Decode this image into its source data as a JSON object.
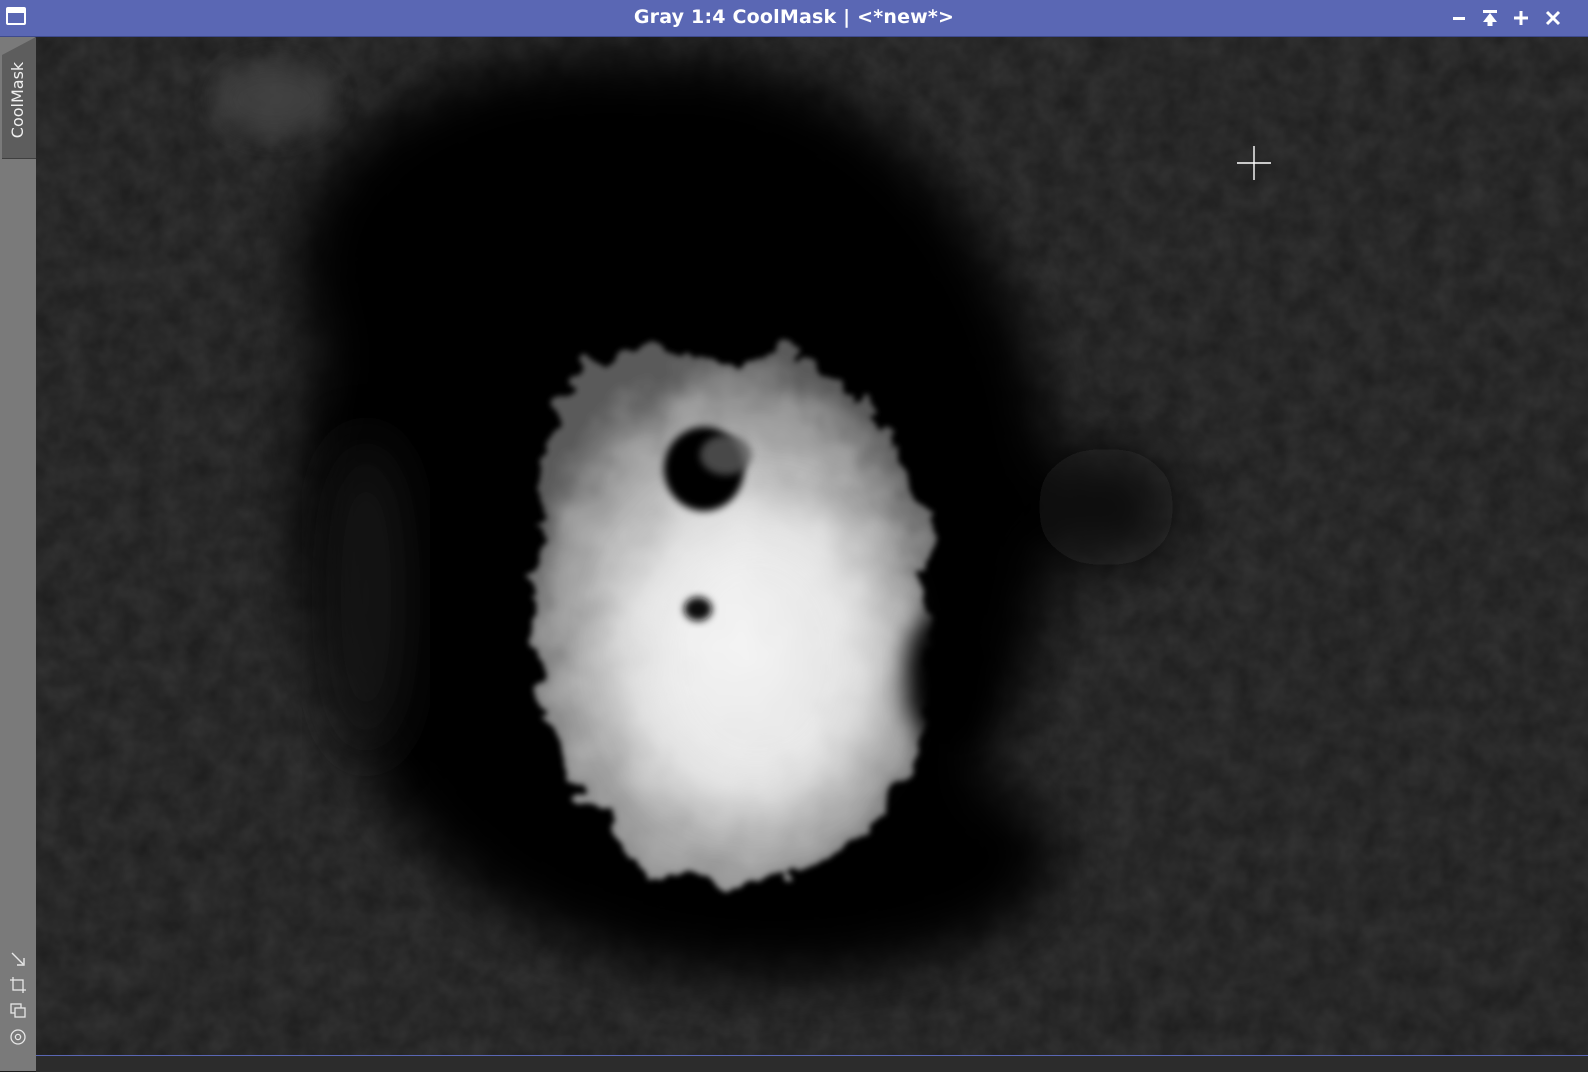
{
  "window": {
    "title": "Gray 1:4 CoolMask | <*new*>",
    "buttons": {
      "minimize": "minimize-icon",
      "shade": "shade-icon",
      "maximize": "maximize-icon",
      "close": "close-icon"
    },
    "colors": {
      "titlebar": "#5a67b4",
      "side_panel": "#7a7a7a"
    }
  },
  "side": {
    "tab_label": "CoolMask",
    "tools": [
      "fit-view-icon",
      "zoom-extents-icon",
      "clone-view-icon",
      "target-icon"
    ]
  },
  "image": {
    "mode": "Gray",
    "zoom": "1:4",
    "id": "CoolMask",
    "description_colors": {
      "background": "#1d1d1d",
      "dark_ring": "#030303",
      "bright_core": "#e6e6e6"
    }
  }
}
